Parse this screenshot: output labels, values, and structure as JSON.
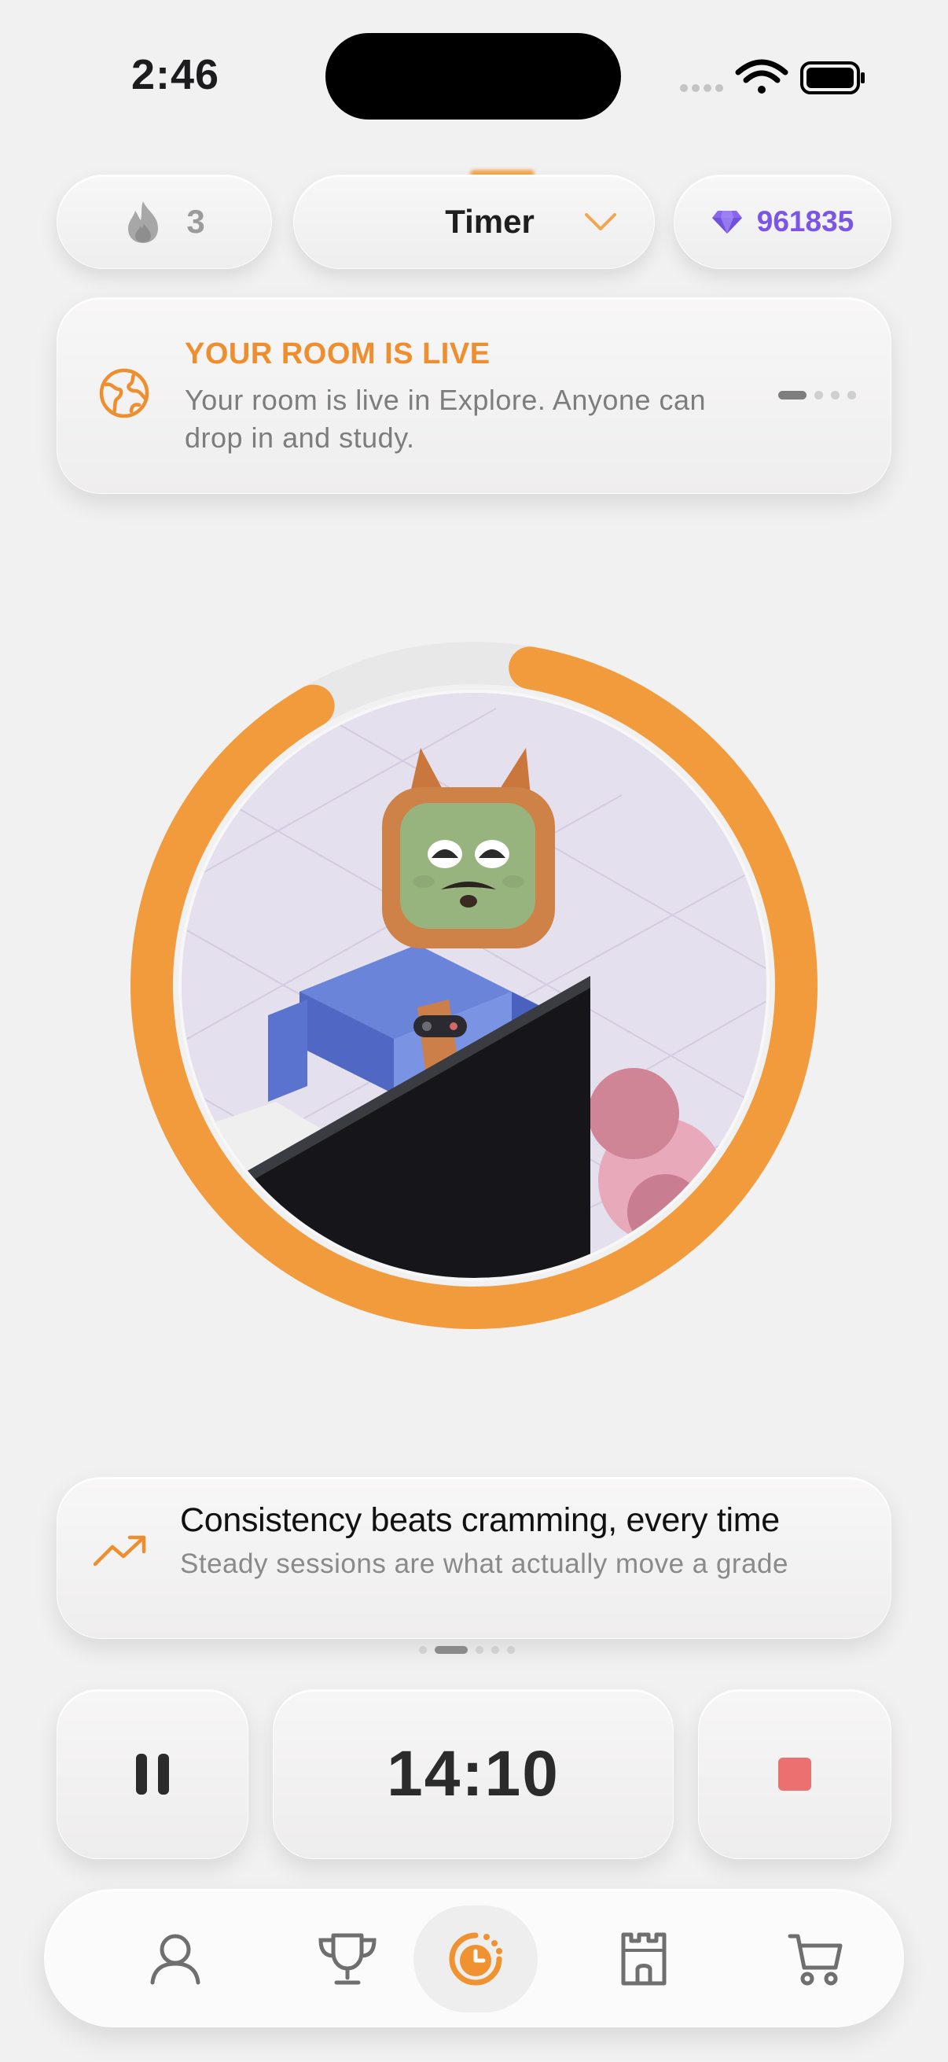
{
  "status_bar": {
    "time": "2:46"
  },
  "top_bar": {
    "streak_count": "3",
    "mode_label": "Timer",
    "gems_count": "961835"
  },
  "banner": {
    "title": "YOUR ROOM IS LIVE",
    "text": "Your room is live in Explore. Anyone can drop in and study.",
    "page_count": 4,
    "active_page": 1
  },
  "session": {
    "progress": 0.97
  },
  "tip": {
    "title": "Consistency beats cramming, every time",
    "text": "Steady sessions are what actually move a grade",
    "page_count": 5,
    "active_page": 2
  },
  "controls": {
    "timer": "14:10"
  },
  "tabs": [
    {
      "name": "profile",
      "icon": "person-icon",
      "active": false
    },
    {
      "name": "leaderboard",
      "icon": "trophy-icon",
      "active": false
    },
    {
      "name": "timer",
      "icon": "timer-icon",
      "active": true
    },
    {
      "name": "castle",
      "icon": "castle-icon",
      "active": false
    },
    {
      "name": "shop",
      "icon": "cart-icon",
      "active": false
    }
  ],
  "colors": {
    "accent": "#f29b3c",
    "banner_title": "#ef8e2e",
    "gems": "#7b55e8",
    "stop": "#ec7070"
  }
}
